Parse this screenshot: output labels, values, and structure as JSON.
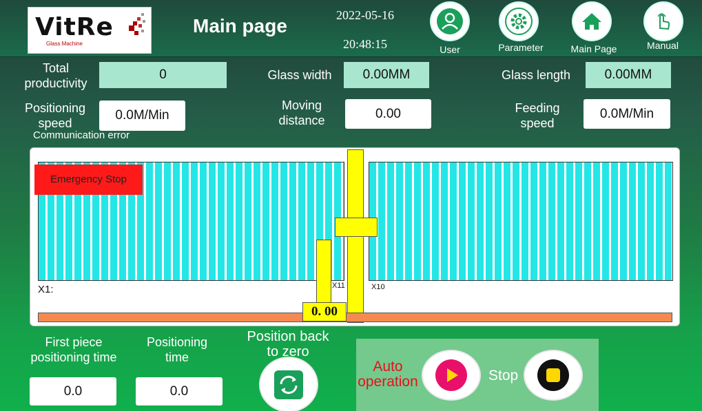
{
  "header": {
    "title": "Main page",
    "date": "2022-05-16",
    "time": "20:48:15",
    "logo_text": "VitRe",
    "logo_sub": "Glass Machine",
    "nav": [
      {
        "label": "User"
      },
      {
        "label": "Parameter"
      },
      {
        "label": "Main Page"
      },
      {
        "label": "Manual"
      }
    ]
  },
  "row1": {
    "total_label": "Total productivity",
    "total_value": "0",
    "width_label": "Glass width",
    "width_value": "0.00MM",
    "length_label": "Glass length",
    "length_value": "0.00MM"
  },
  "row2": {
    "pos_speed_label": "Positioning speed",
    "pos_speed_value": "0.0M/Min",
    "moving_label": "Moving distance",
    "moving_value": "0.00",
    "feed_label": "Feeding speed",
    "feed_value": "0.0M/Min"
  },
  "status": {
    "comm_error": "Communication error",
    "estop": "Emergency Stop"
  },
  "diagram": {
    "left_tag": "X1:",
    "mid_tag": "X11",
    "right_tag": "X10",
    "readout": "0. 00"
  },
  "bottom": {
    "first_label": "First piece positioning time",
    "first_value": "0.0",
    "pos_time_label": "Positioning time",
    "pos_time_value": "0.0",
    "zero_label": "Position back to zero",
    "auto_label": "Auto operation",
    "stop_label": "Stop"
  },
  "colors": {
    "auto_text": "#e8101a",
    "rack": "#24e6e6",
    "estop": "#ff1a1a"
  }
}
